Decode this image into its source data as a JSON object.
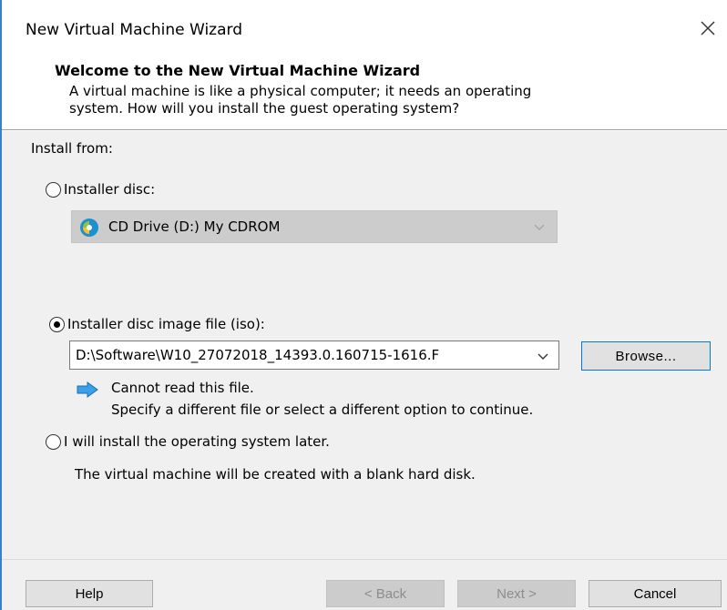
{
  "window": {
    "title": "New Virtual Machine Wizard",
    "accent": "#3b7fc4"
  },
  "header": {
    "title": "Welcome to the New Virtual Machine Wizard",
    "subtitle_line1": "A virtual machine is like a physical computer; it needs an operating",
    "subtitle_line2": "system. How will you install the guest operating system?"
  },
  "install": {
    "label": "Install from:",
    "options": [
      {
        "label": "Installer disc:",
        "selected": false
      },
      {
        "label": "Installer disc image file (iso):",
        "selected": true
      },
      {
        "label": "I will install the operating system later.",
        "selected": false
      }
    ],
    "disc_drive": {
      "value": "CD Drive (D:) My CDROM",
      "enabled": false,
      "icon": "cd-drive-icon"
    },
    "iso_path": {
      "value": "D:\\Software\\W10_27072018_14393.0.160715-1616.F"
    },
    "browse_label": "Browse...",
    "warning": {
      "icon": "arrow-right-icon",
      "line1": "Cannot read this file.",
      "line2": "Specify a different file or select a different option to continue."
    },
    "later_note": "The virtual machine will be created with a blank hard disk."
  },
  "footer": {
    "help": "Help",
    "back": "< Back",
    "next": "Next >",
    "cancel": "Cancel"
  }
}
